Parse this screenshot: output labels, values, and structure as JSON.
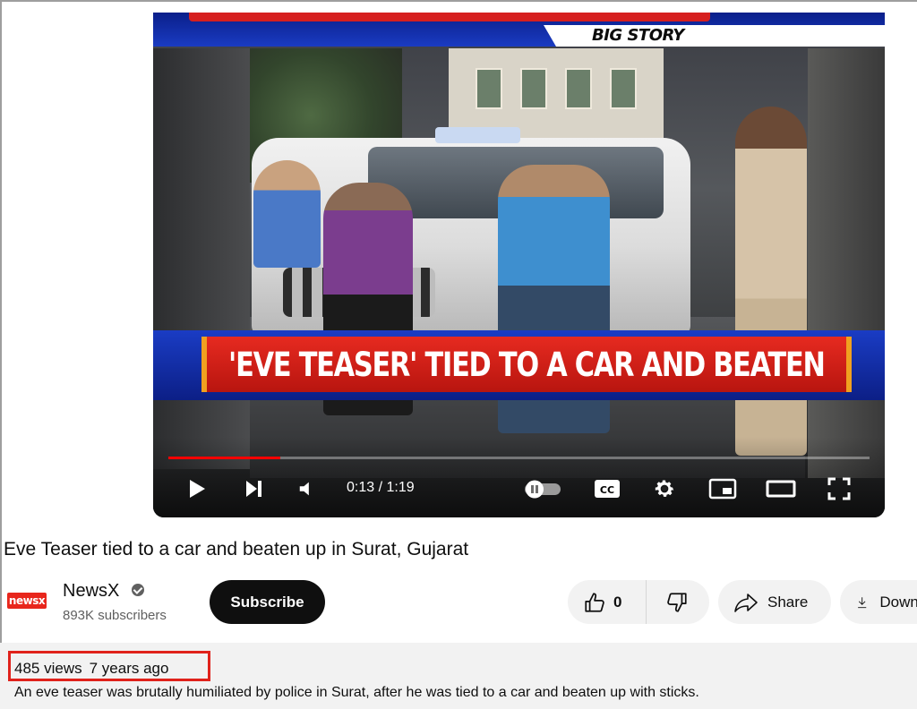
{
  "video": {
    "banner_tag": "BIG STORY",
    "headline_overlay": "'EVE TEASER' TIED TO A CAR AND BEATEN",
    "time": "0:13 / 1:19",
    "progress": 0.16
  },
  "title": "Eve Teaser tied to a car and beaten up in Surat, Gujarat",
  "channel": {
    "logo_text": "newsx",
    "name": "NewsX",
    "subscribers": "893K subscribers",
    "subscribe_label": "Subscribe"
  },
  "actions": {
    "like_count": "0",
    "share_label": "Share",
    "download_label": "Download"
  },
  "description": {
    "views": "485 views",
    "age": "7 years ago",
    "text": "An eve teaser was brutally humiliated by police in Surat, after he was tied to a car and beaten up with sticks."
  },
  "colors": {
    "accent_red": "#ff0000",
    "highlight_box": "#e0221b",
    "subscribe_bg": "#0f0f0f"
  }
}
